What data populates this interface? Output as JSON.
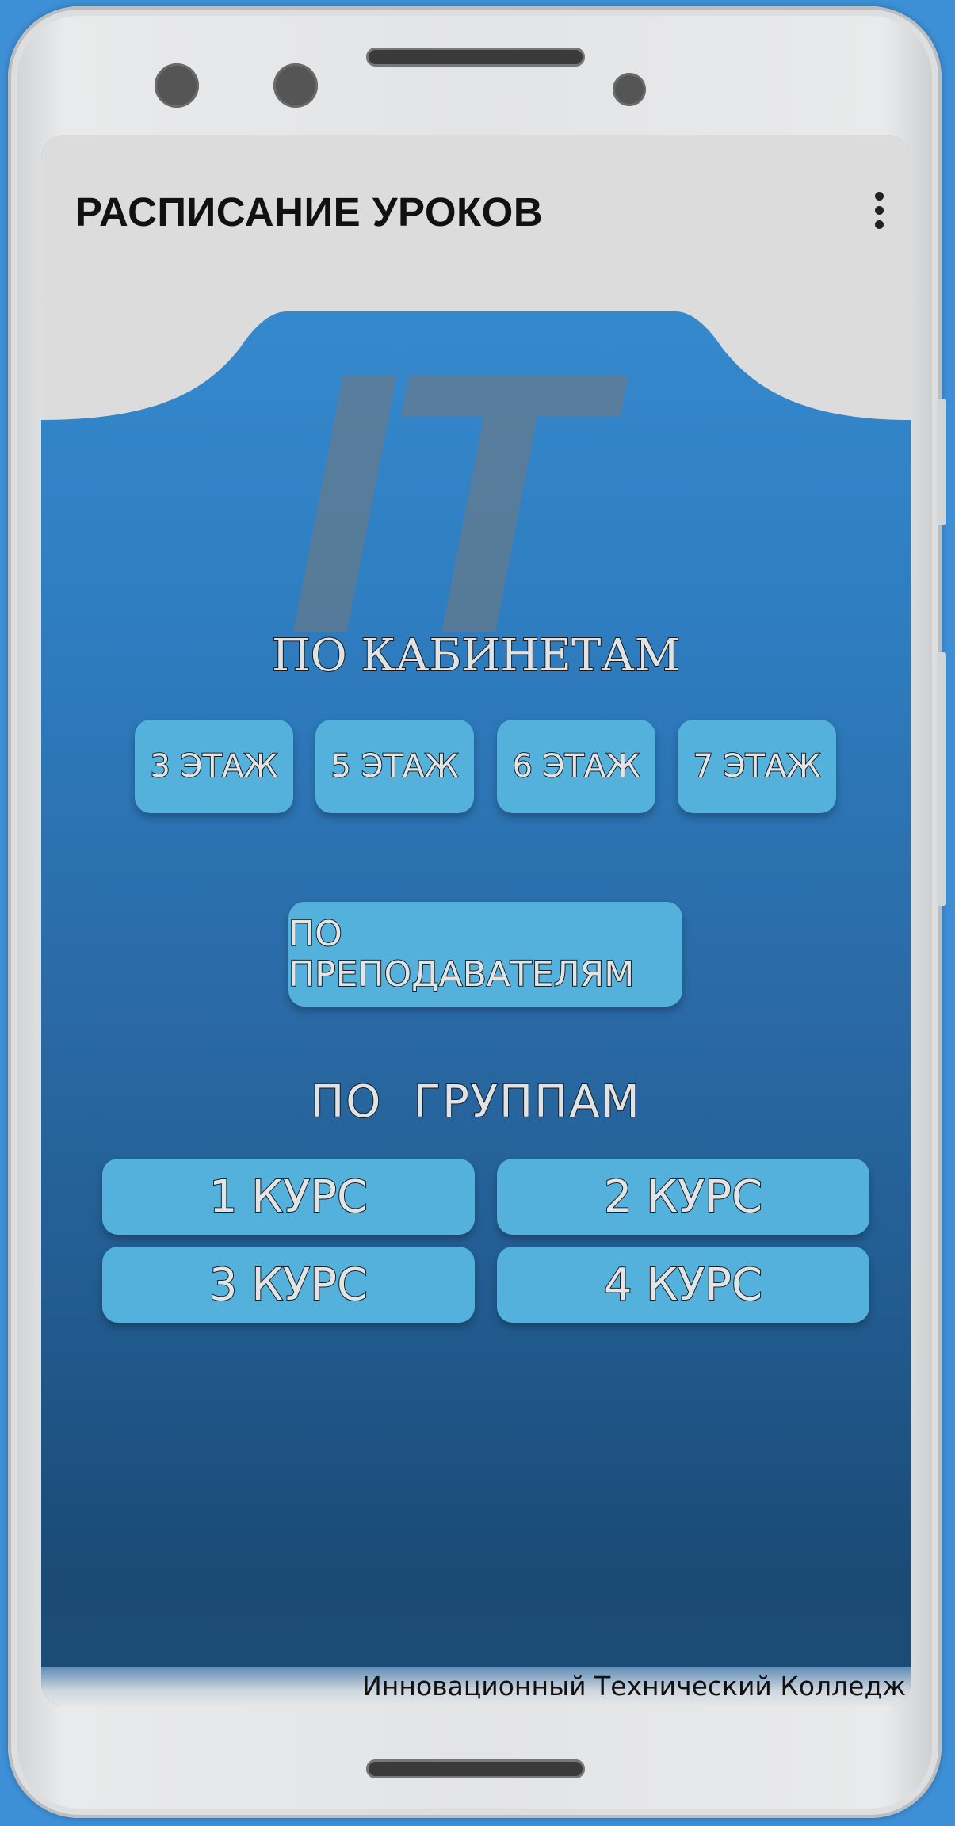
{
  "app_bar": {
    "title": "РАСПИСАНИЕ УРОКОВ"
  },
  "logo": {
    "text": "IT"
  },
  "cabinets": {
    "title": "ПО КАБИНЕТАМ",
    "floors": [
      "3 ЭТАЖ",
      "5 ЭТАЖ",
      "6 ЭТАЖ",
      "7 ЭТАЖ"
    ]
  },
  "teachers": {
    "label": "ПО ПРЕПОДАВАТЕЛЯМ"
  },
  "groups": {
    "title": "ПО  ГРУППАМ",
    "courses": [
      "1 КУРС",
      "2 КУРС",
      "3 КУРС",
      "4 КУРС"
    ]
  },
  "footer": {
    "text": "Инновационный Технический Колледж"
  },
  "colors": {
    "device_background": "#3d8fd6",
    "button": "#54b1dc",
    "app_bar": "#dcdcdd"
  }
}
